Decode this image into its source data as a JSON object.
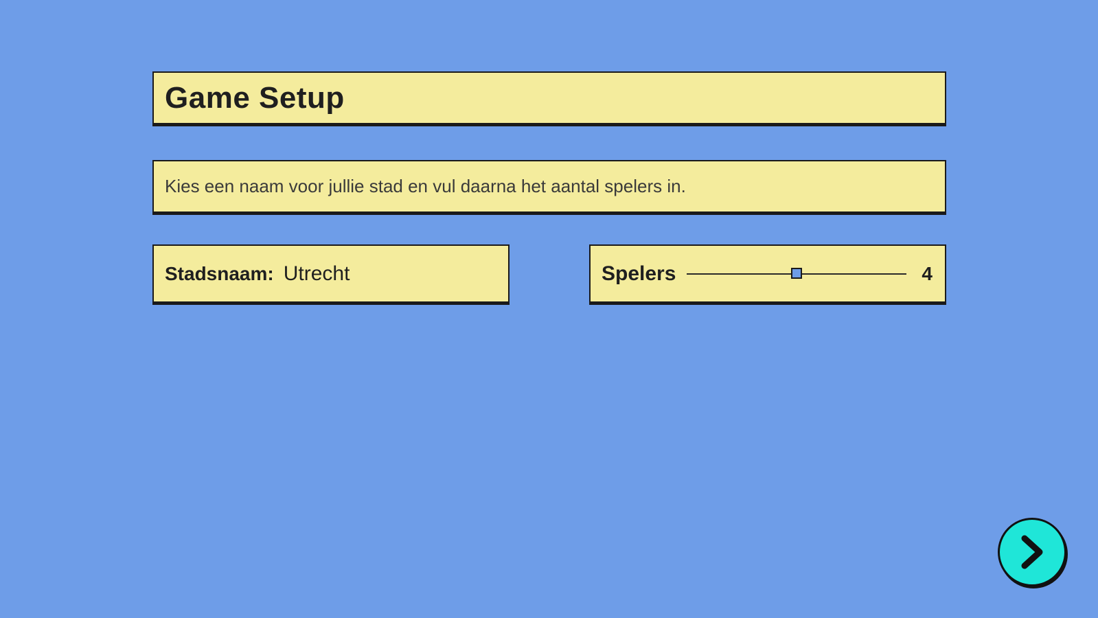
{
  "title": "Game Setup",
  "instruction": "Kies een naam voor jullie stad en vul daarna het aantal spelers in.",
  "city": {
    "label": "Stadsnaam:",
    "value": "Utrecht"
  },
  "players": {
    "label": "Spelers",
    "value": "4",
    "slider_fraction": 0.5
  },
  "next_button": {
    "icon": "chevron-right-icon"
  },
  "colors": {
    "background": "#6e9de8",
    "panel": "#f4ec9d",
    "border": "#1a1a1a",
    "next_button": "#1fe6d8"
  }
}
